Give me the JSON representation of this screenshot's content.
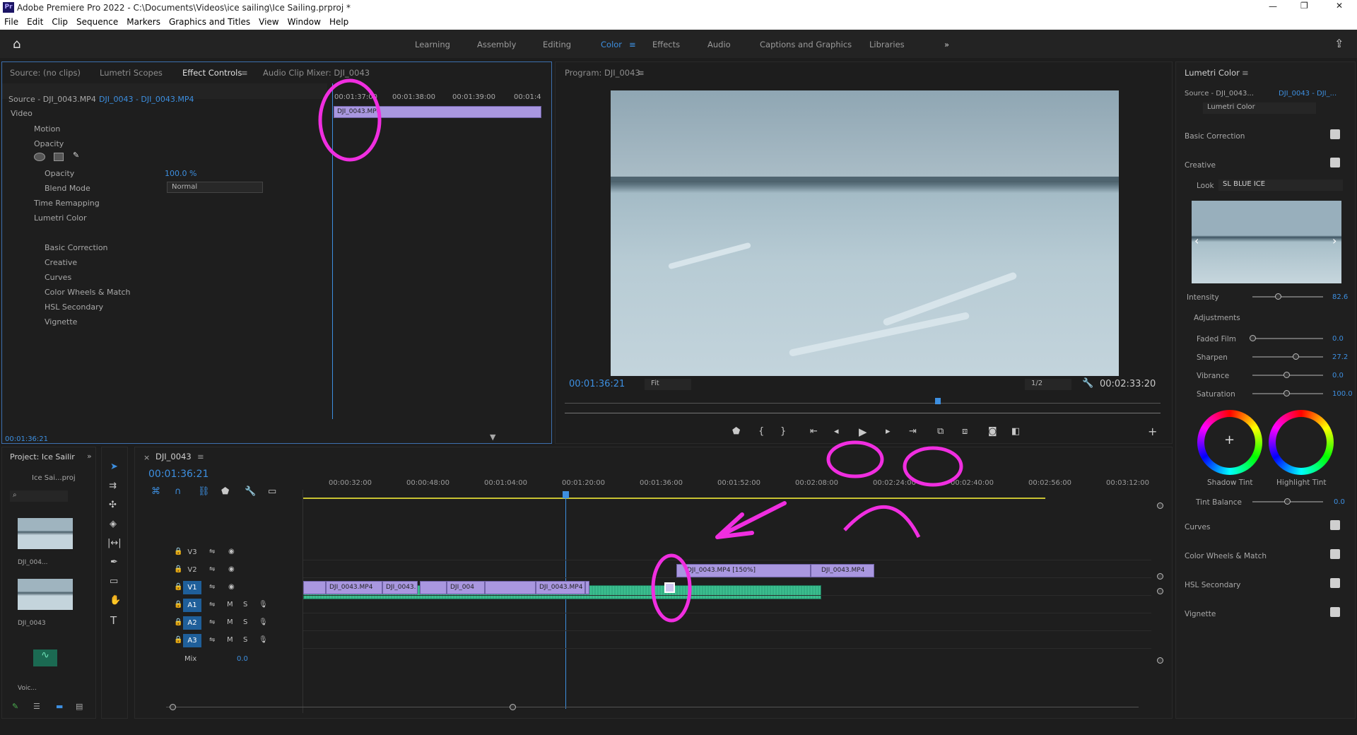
{
  "titlebar": {
    "app_icon": "Pr",
    "title": "Adobe Premiere Pro 2022 - C:\\Documents\\Videos\\ice sailing\\Ice Sailing.prproj *"
  },
  "menu": [
    "File",
    "Edit",
    "Clip",
    "Sequence",
    "Markers",
    "Graphics and Titles",
    "View",
    "Window",
    "Help"
  ],
  "workspaces": [
    "Learning",
    "Assembly",
    "Editing",
    "Color",
    "Effects",
    "Audio",
    "Captions and Graphics",
    "Libraries"
  ],
  "effect_controls": {
    "tabs": [
      "Source: (no clips)",
      "Lumetri Scopes",
      "Effect Controls",
      "Audio Clip Mixer: DJI_0043"
    ],
    "source_label": "Source - DJI_0043.MP4",
    "sequence_label": "DJI_0043 - DJI_0043.MP4",
    "video_header": "Video",
    "rows": [
      "Motion",
      "Opacity",
      "Opacity",
      "Blend Mode",
      "Time Remapping",
      "Lumetri Color",
      "Basic Correction",
      "Creative",
      "Curves",
      "Color Wheels & Match",
      "HSL Secondary",
      "Vignette"
    ],
    "opacity_value": "100.0 %",
    "blend_mode": "Normal",
    "ruler": [
      "00:01:37:00",
      "00:01:38:00",
      "00:01:39:00",
      "00:01:4"
    ],
    "clip_name": "DJI_0043.MP4",
    "timecode": "00:01:36:21"
  },
  "program": {
    "title": "Program: DJI_0043",
    "timecode": "00:01:36:21",
    "fit": "Fit",
    "quality": "1/2",
    "duration": "00:02:33:20"
  },
  "lumetri": {
    "title": "Lumetri Color",
    "source": "Source - DJI_0043...",
    "sequence": "DJI_0043 - DJI_...",
    "fx": "Lumetri Color",
    "sections": [
      "Basic Correction",
      "Creative"
    ],
    "look_label": "Look",
    "look_value": "SL BLUE ICE",
    "intensity_label": "Intensity",
    "intensity_value": "82.6",
    "adjustments": "Adjustments",
    "sliders": [
      {
        "label": "Faded Film",
        "value": "0.0",
        "pos": 0.0
      },
      {
        "label": "Sharpen",
        "value": "27.2",
        "pos": 0.64
      },
      {
        "label": "Vibrance",
        "value": "0.0",
        "pos": 0.5
      },
      {
        "label": "Saturation",
        "value": "100.0",
        "pos": 0.5
      }
    ],
    "shadow_tint": "Shadow Tint",
    "highlight_tint": "Highlight Tint",
    "tint_balance_label": "Tint Balance",
    "tint_balance_value": "0.0",
    "bottom_sections": [
      "Curves",
      "Color Wheels & Match",
      "HSL Secondary",
      "Vignette"
    ]
  },
  "project": {
    "tab": "Project: Ice Sailir",
    "bin": "Ice Sai...proj",
    "items": [
      "DJI_004...",
      "DJI_0043",
      "Voic..."
    ]
  },
  "timeline": {
    "tab": "DJI_0043",
    "timecode": "00:01:36:21",
    "ruler": [
      "00:00:32:00",
      "00:00:48:00",
      "00:01:04:00",
      "00:01:20:00",
      "00:01:36:00",
      "00:01:52:00",
      "00:02:08:00",
      "00:02:24:00",
      "00:02:40:00",
      "00:02:56:00",
      "00:03:12:00"
    ],
    "tracks": [
      "V3",
      "V2",
      "V1",
      "A1",
      "A2",
      "A3"
    ],
    "mix_label": "Mix",
    "mix_value": "0.0",
    "v1_clips": [
      "DJI_0043.MP4",
      "DJI_0043.",
      "",
      "DJI_004",
      "DJI_0043.MP4"
    ],
    "v2_clips": [
      "DJI_0043.MP4 [150%]",
      "DJI_0043.MP4"
    ]
  },
  "colors": {
    "accent": "#3d8fe0",
    "clip_video": "#a997e0",
    "clip_audio": "#2fa77e",
    "annotation": "#f02ee0"
  }
}
